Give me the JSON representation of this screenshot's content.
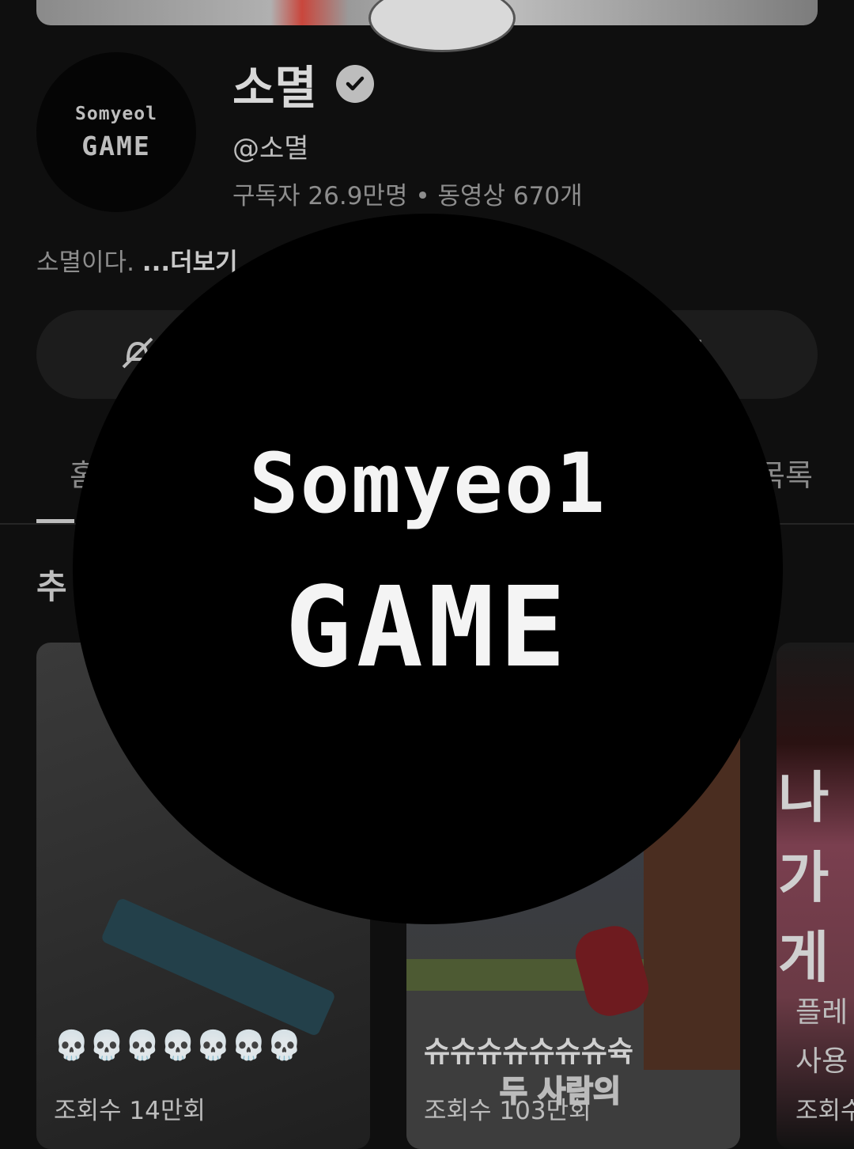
{
  "channel": {
    "name": "소멸",
    "handle": "@소멸",
    "subscribers": "구독자 26.9만명",
    "separator": "•",
    "videos": "동영상 670개",
    "description": "소멸이다.",
    "more_label": "...더보기",
    "avatar_line1": "Somyeol",
    "avatar_line2": "GAME"
  },
  "tabs": {
    "left_partial": "홈",
    "right_partial": "목록"
  },
  "section": {
    "title_partial": "추"
  },
  "videos": [
    {
      "title": "💀💀💀💀💀💀💀",
      "views": "조회수 14만회"
    },
    {
      "title": "슈슈슈슈슈슈슈슉",
      "views": "조회수 103만회",
      "overlay": "두 사람의"
    },
    {
      "title_line1": "플레",
      "title_line2": "사용",
      "views": "조회수",
      "thumb_text": "나가게"
    }
  ],
  "zoomed_avatar": {
    "line1": "Somyeo1",
    "line2": "GAME"
  }
}
